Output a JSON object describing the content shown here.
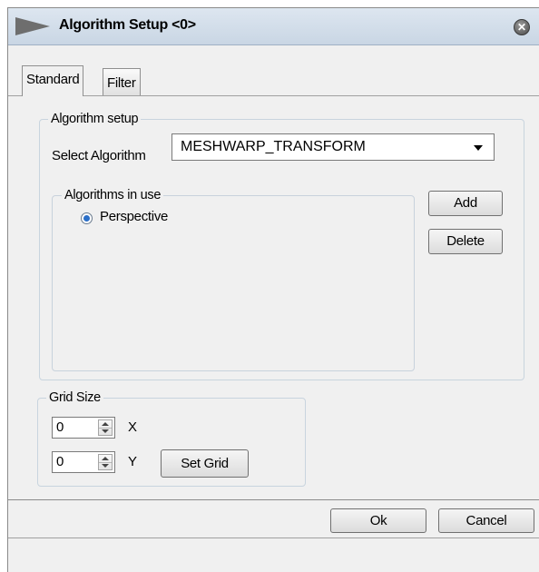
{
  "window": {
    "title": "Algorithm Setup <0>",
    "close_glyph": "✕"
  },
  "tabs": [
    {
      "label": "Standard",
      "active": true
    },
    {
      "label": "Filter",
      "active": false
    }
  ],
  "algorithm_setup": {
    "legend": "Algorithm setup",
    "select_label": "Select Algorithm",
    "selected_algorithm": "MESHWARP_TRANSFORM",
    "in_use": {
      "legend": "Algorithms in use",
      "items": [
        {
          "label": "Perspective",
          "selected": true
        }
      ]
    },
    "add_label": "Add",
    "delete_label": "Delete"
  },
  "grid_size": {
    "legend": "Grid Size",
    "x_value": "0",
    "x_label": "X",
    "y_value": "0",
    "y_label": "Y",
    "set_grid_label": "Set Grid"
  },
  "footer": {
    "ok_label": "Ok",
    "cancel_label": "Cancel"
  },
  "colors": {
    "radio_selected": "#2b6fc8",
    "titlebar": "#d3dfeb"
  }
}
